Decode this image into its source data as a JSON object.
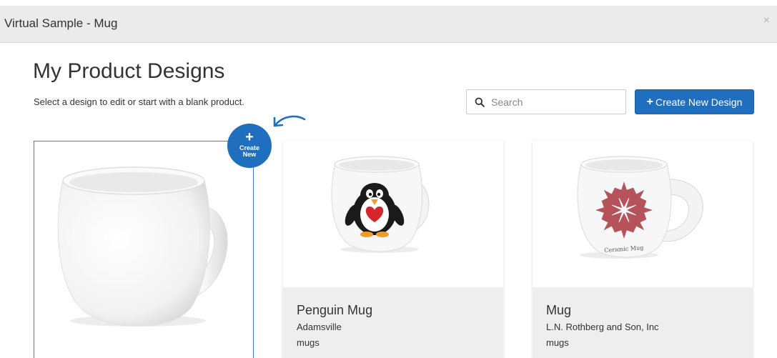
{
  "window": {
    "title": "Virtual Sample - Mug",
    "close_glyph": "×"
  },
  "page": {
    "heading": "My Product Designs",
    "subtext": "Select a design to edit or start with a blank product."
  },
  "search": {
    "placeholder": "Search",
    "value": "",
    "icon": "search-icon"
  },
  "create_button": {
    "plus": "+",
    "label": "Create New Design"
  },
  "create_badge": {
    "plus": "+",
    "label": "Create New"
  },
  "cards": [
    {
      "name": "Penguin Mug",
      "company": "Adamsville",
      "category": "mugs",
      "image": "penguin-mug"
    },
    {
      "name": "Mug",
      "company": "L.N. Rothberg and Son, Inc",
      "category": "mugs",
      "image": "flower-mug",
      "print_text": "Ceramic Mug"
    }
  ],
  "colors": {
    "accent": "#1f6fbe",
    "flower": "#b5525a"
  }
}
